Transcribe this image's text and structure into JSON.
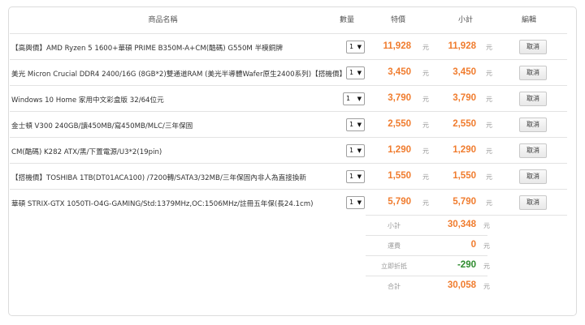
{
  "headers": {
    "name": "商品名稱",
    "qty": "數量",
    "price": "特價",
    "subtotal": "小計",
    "edit": "編輯"
  },
  "currency": "元",
  "cancel_label": "取消",
  "items": [
    {
      "name": "【高興價】AMD Ryzen 5 1600+華碩 PRIME B350M-A+CM(酷碼) G550M 半模銅牌",
      "qty": "1",
      "price": "11,928",
      "subtotal": "11,928"
    },
    {
      "name": "美光 Micron Crucial DDR4 2400/16G (8GB*2)雙通道RAM (美光半導體Wafer原生2400系列)【搭機價】",
      "qty": "1",
      "price": "3,450",
      "subtotal": "3,450"
    },
    {
      "name": "Windows 10 Home 家用中文彩盒版 32/64位元",
      "qty": "1",
      "price": "3,790",
      "subtotal": "3,790"
    },
    {
      "name": "金士頓 V300 240GB/讀450MB/寫450MB/MLC/三年保固",
      "qty": "1",
      "price": "2,550",
      "subtotal": "2,550"
    },
    {
      "name": "CM(酷碼) K282 ATX/黑/下置電源/U3*2(19pin)",
      "qty": "1",
      "price": "1,290",
      "subtotal": "1,290"
    },
    {
      "name": "【搭機價】TOSHIBA 1TB(DT01ACA100) /7200轉/SATA3/32MB/三年保固內非人為直接換新",
      "qty": "1",
      "price": "1,550",
      "subtotal": "1,550"
    },
    {
      "name": "華碩 STRIX-GTX 1050TI-O4G-GAMING/Std:1379MHz,OC:1506MHz/註冊五年保(長24.1cm)",
      "qty": "1",
      "price": "5,790",
      "subtotal": "5,790"
    }
  ],
  "summary": {
    "subtotal_label": "小計",
    "subtotal_value": "30,348",
    "shipping_label": "運費",
    "shipping_value": "0",
    "discount_label": "立即折抵",
    "discount_value": "-290",
    "total_label": "合計",
    "total_value": "30,058"
  },
  "colors": {
    "price": "#f07c2e",
    "discount": "#2e8b2e",
    "border": "#e3e3e3"
  }
}
